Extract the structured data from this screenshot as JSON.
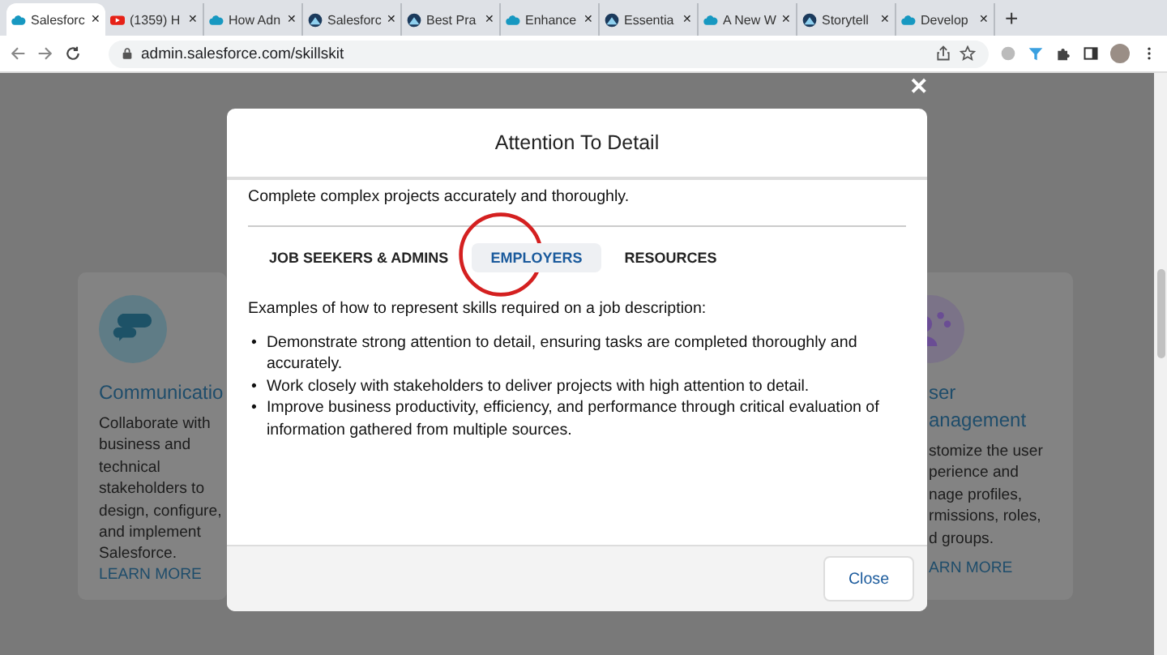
{
  "browser": {
    "tabs": [
      {
        "label": "Salesforc",
        "kind": "cloud",
        "close": "✕",
        "selected": true
      },
      {
        "label": "(1359) H",
        "kind": "video",
        "close": "✕",
        "selected": false
      },
      {
        "label": "How Adn",
        "kind": "cloud",
        "close": "✕",
        "selected": false
      },
      {
        "label": "Salesforc",
        "kind": "mountain",
        "close": "✕",
        "selected": false
      },
      {
        "label": "Best Pra",
        "kind": "mountain",
        "close": "✕",
        "selected": false
      },
      {
        "label": "Enhance",
        "kind": "cloud",
        "close": "✕",
        "selected": false
      },
      {
        "label": "Essentia",
        "kind": "mountain",
        "close": "✕",
        "selected": false
      },
      {
        "label": "A New W",
        "kind": "cloud",
        "close": "✕",
        "selected": false
      },
      {
        "label": "Storytell",
        "kind": "mountain",
        "close": "✕",
        "selected": false
      },
      {
        "label": "Develop",
        "kind": "cloud",
        "close": "✕",
        "selected": false
      }
    ],
    "new_tab": "+",
    "address": "admin.salesforce.com/skillskit"
  },
  "cards": [
    {
      "title_lines": [
        "Communicatio"
      ],
      "description_lines": [
        "Collaborate with",
        "business and",
        "technical",
        "stakeholders to",
        "design, configure,",
        "and implement",
        "Salesforce."
      ],
      "link": "LEARN MORE",
      "kind": "chat"
    },
    {
      "title_lines": [
        "ser",
        "anagement"
      ],
      "description_lines": [
        "stomize the user",
        "perience and",
        "nage profiles,",
        "rmissions, roles,",
        "d groups."
      ],
      "link": "ARN MORE",
      "kind": "people"
    }
  ],
  "close_overlay": "✕",
  "modal": {
    "title": "Attention To Detail",
    "intro": "Complete complex projects accurately and thoroughly.",
    "tabs": [
      {
        "label": "JOB SEEKERS & ADMINS",
        "selected": false
      },
      {
        "label": "EMPLOYERS",
        "selected": true
      },
      {
        "label": "RESOURCES",
        "selected": false
      }
    ],
    "lead": "Examples of how to represent skills required on a job description:",
    "bullets": [
      {
        "marker": "•",
        "text": "Demonstrate strong attention to detail, ensuring tasks are completed thoroughly and accurately."
      },
      {
        "marker": "•",
        "text": "Work closely with stakeholders to deliver projects with high attention to detail."
      },
      {
        "marker": "•",
        "text": "Improve business productivity, efficiency, and performance through critical evaluation of information gathered from multiple sources."
      }
    ],
    "close_button": "Close"
  }
}
